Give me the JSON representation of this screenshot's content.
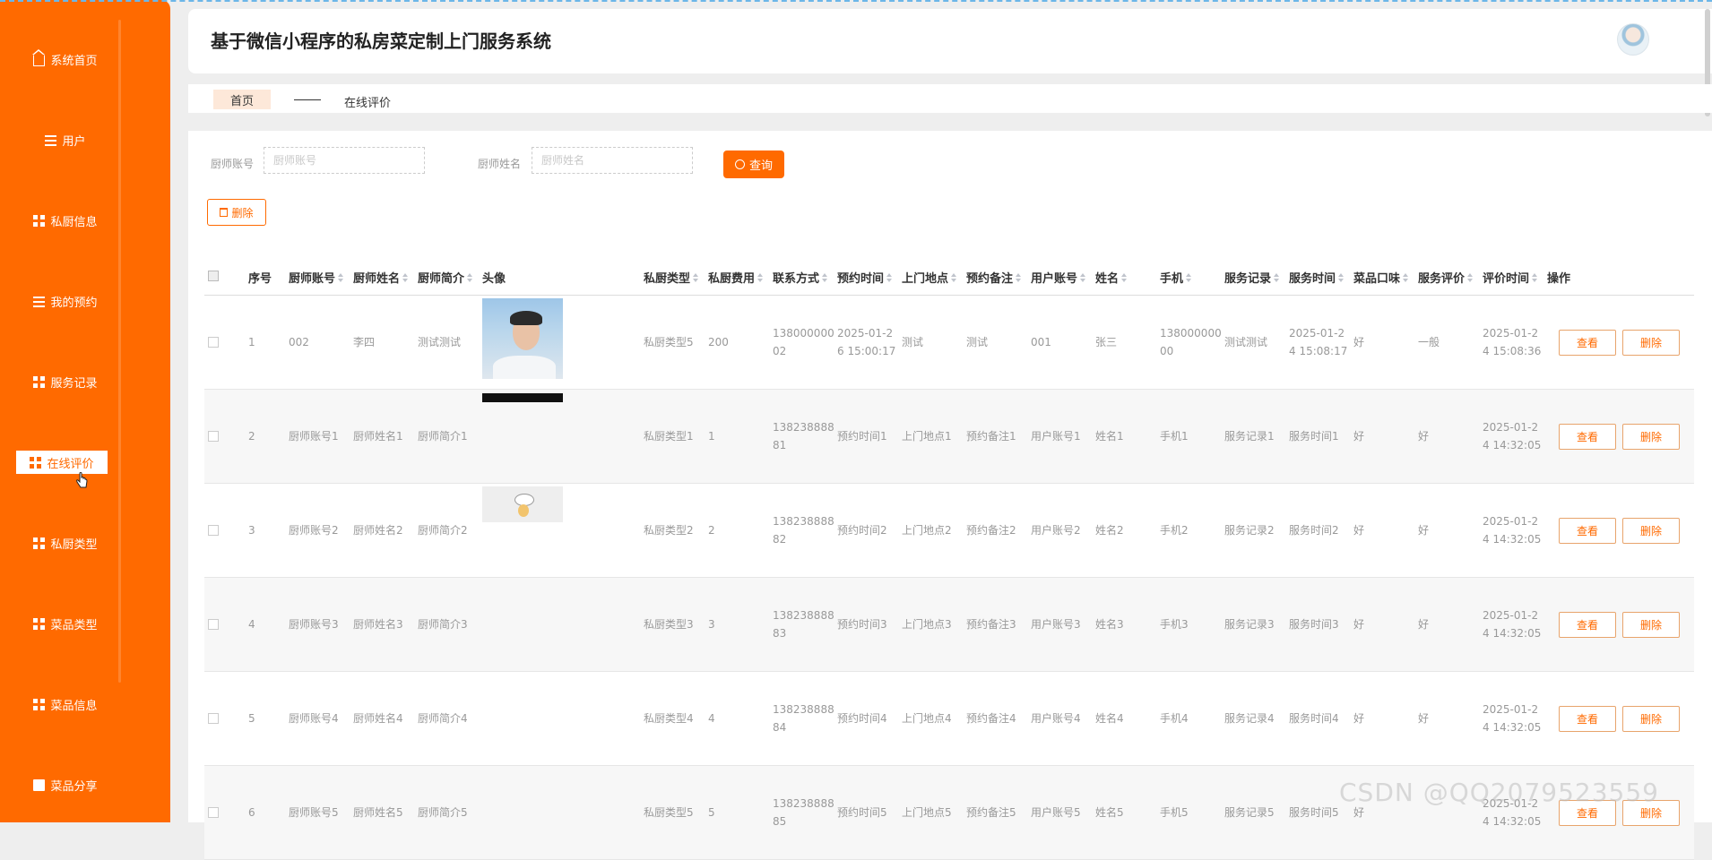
{
  "app": {
    "title": "基于微信小程序的私房菜定制上门服务系统"
  },
  "sidebar": {
    "items": [
      {
        "label": "系统首页",
        "icon": "home-icon"
      },
      {
        "label": "用户",
        "icon": "list-icon"
      },
      {
        "label": "私厨信息",
        "icon": "grid-icon"
      },
      {
        "label": "我的预约",
        "icon": "list-icon"
      },
      {
        "label": "服务记录",
        "icon": "grid-icon"
      },
      {
        "label": "在线评价",
        "icon": "grid-icon",
        "active": true
      },
      {
        "label": "私厨类型",
        "icon": "grid-icon"
      },
      {
        "label": "菜品类型",
        "icon": "grid-icon"
      },
      {
        "label": "菜品信息",
        "icon": "grid-icon"
      },
      {
        "label": "菜品分享",
        "icon": "monitor-icon"
      }
    ]
  },
  "breadcrumb": {
    "home": "首页",
    "current": "在线评价"
  },
  "search": {
    "account_label": "厨师账号",
    "account_placeholder": "厨师账号",
    "name_label": "厨师姓名",
    "name_placeholder": "厨师姓名",
    "query_label": "查询"
  },
  "toolbar": {
    "delete_label": "删除"
  },
  "table": {
    "headers": [
      "序号",
      "厨师账号",
      "厨师姓名",
      "厨师简介",
      "头像",
      "私厨类型",
      "私厨费用",
      "联系方式",
      "预约时间",
      "上门地点",
      "预约备注",
      "用户账号",
      "姓名",
      "手机",
      "服务记录",
      "服务时间",
      "菜品口味",
      "服务评价",
      "评价时间",
      "操作"
    ],
    "view_label": "查看",
    "delete_label": "删除",
    "rows": [
      {
        "no": "1",
        "account": "002",
        "name": "李四",
        "intro": "测试测试",
        "type": "私厨类型5",
        "fee": "200",
        "phone_a": "138000000",
        "phone_b": "02",
        "appt_a": "2025-01-2",
        "appt_b": "6 15:00:17",
        "place": "测试",
        "remark": "测试",
        "user": "001",
        "uname": "张三",
        "mobile_a": "138000000",
        "mobile_b": "00",
        "record": "测试测试",
        "stime_a": "2025-01-2",
        "stime_b": "4 15:08:17",
        "taste": "好",
        "review": "一般",
        "rtime_a": "2025-01-2",
        "rtime_b": "4 15:08:36"
      },
      {
        "no": "2",
        "account": "厨师账号1",
        "name": "厨师姓名1",
        "intro": "厨师简介1",
        "type": "私厨类型1",
        "fee": "1",
        "phone_a": "138238888",
        "phone_b": "81",
        "appt_a": "预约时间1",
        "appt_b": "",
        "place": "上门地点1",
        "remark": "预约备注1",
        "user": "用户账号1",
        "uname": "姓名1",
        "mobile_a": "手机1",
        "mobile_b": "",
        "record": "服务记录1",
        "stime_a": "服务时间1",
        "stime_b": "",
        "taste": "好",
        "review": "好",
        "rtime_a": "2025-01-2",
        "rtime_b": "4 14:32:05"
      },
      {
        "no": "3",
        "account": "厨师账号2",
        "name": "厨师姓名2",
        "intro": "厨师简介2",
        "type": "私厨类型2",
        "fee": "2",
        "phone_a": "138238888",
        "phone_b": "82",
        "appt_a": "预约时间2",
        "appt_b": "",
        "place": "上门地点2",
        "remark": "预约备注2",
        "user": "用户账号2",
        "uname": "姓名2",
        "mobile_a": "手机2",
        "mobile_b": "",
        "record": "服务记录2",
        "stime_a": "服务时间2",
        "stime_b": "",
        "taste": "好",
        "review": "好",
        "rtime_a": "2025-01-2",
        "rtime_b": "4 14:32:05"
      },
      {
        "no": "4",
        "account": "厨师账号3",
        "name": "厨师姓名3",
        "intro": "厨师简介3",
        "type": "私厨类型3",
        "fee": "3",
        "phone_a": "138238888",
        "phone_b": "83",
        "appt_a": "预约时间3",
        "appt_b": "",
        "place": "上门地点3",
        "remark": "预约备注3",
        "user": "用户账号3",
        "uname": "姓名3",
        "mobile_a": "手机3",
        "mobile_b": "",
        "record": "服务记录3",
        "stime_a": "服务时间3",
        "stime_b": "",
        "taste": "好",
        "review": "好",
        "rtime_a": "2025-01-2",
        "rtime_b": "4 14:32:05"
      },
      {
        "no": "5",
        "account": "厨师账号4",
        "name": "厨师姓名4",
        "intro": "厨师简介4",
        "type": "私厨类型4",
        "fee": "4",
        "phone_a": "138238888",
        "phone_b": "84",
        "appt_a": "预约时间4",
        "appt_b": "",
        "place": "上门地点4",
        "remark": "预约备注4",
        "user": "用户账号4",
        "uname": "姓名4",
        "mobile_a": "手机4",
        "mobile_b": "",
        "record": "服务记录4",
        "stime_a": "服务时间4",
        "stime_b": "",
        "taste": "好",
        "review": "好",
        "rtime_a": "2025-01-2",
        "rtime_b": "4 14:32:05"
      },
      {
        "no": "6",
        "account": "厨师账号5",
        "name": "厨师姓名5",
        "intro": "厨师简介5",
        "type": "私厨类型5",
        "fee": "5",
        "phone_a": "138238888",
        "phone_b": "85",
        "appt_a": "预约时间5",
        "appt_b": "",
        "place": "上门地点5",
        "remark": "预约备注5",
        "user": "用户账号5",
        "uname": "姓名5",
        "mobile_a": "手机5",
        "mobile_b": "",
        "record": "服务记录5",
        "stime_a": "服务时间5",
        "stime_b": "",
        "taste": "好",
        "review": "",
        "rtime_a": "2025-01-2",
        "rtime_b": "4 14:32:05"
      }
    ]
  },
  "watermark": "CSDN @QQ2079523559",
  "colors": {
    "accent": "#ff6a00",
    "crumb_bg": "#fde8d9"
  }
}
